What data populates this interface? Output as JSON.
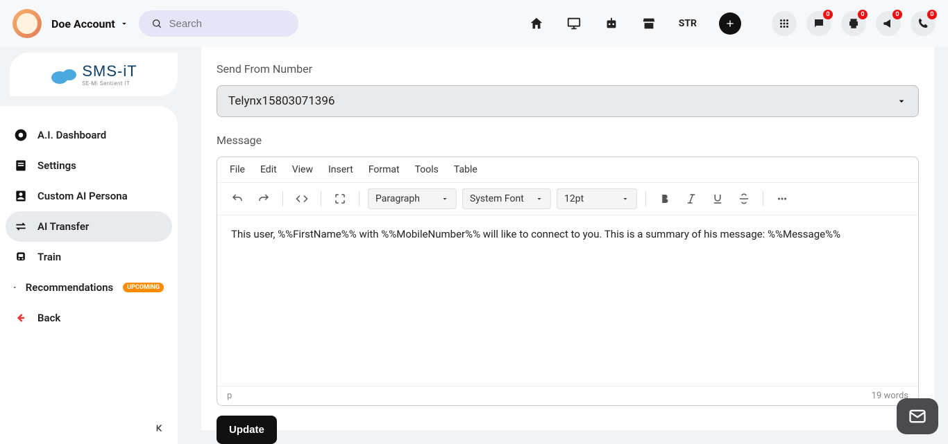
{
  "header": {
    "account_name": "Doe Account",
    "search_placeholder": "Search",
    "str_label": "STR",
    "badges": {
      "chat": "0",
      "print": "0",
      "announce": "0",
      "phone": "0"
    }
  },
  "logo": {
    "main": "SMS-iT",
    "sub": "SE-Mi Sentient iT"
  },
  "sidebar": {
    "items": [
      {
        "label": "A.I. Dashboard"
      },
      {
        "label": "Settings"
      },
      {
        "label": "Custom AI Persona"
      },
      {
        "label": "AI Transfer"
      },
      {
        "label": "Train"
      },
      {
        "label": "Recommendations"
      },
      {
        "label": "Back"
      }
    ],
    "upcoming_tag": "UPCOMING"
  },
  "form": {
    "send_from_label": "Send From Number",
    "send_from_value": "Telynx15803071396",
    "message_label": "Message",
    "editor": {
      "menus": [
        "File",
        "Edit",
        "View",
        "Insert",
        "Format",
        "Tools",
        "Table"
      ],
      "paragraph": "Paragraph",
      "font_family": "System Font",
      "font_size": "12pt",
      "body": "This user, %%FirstName%% with %%MobileNumber%% will like to connect to you. This is a summary of his message: %%Message%%",
      "path": "p",
      "word_count": "19 words"
    },
    "update_button": "Update"
  }
}
